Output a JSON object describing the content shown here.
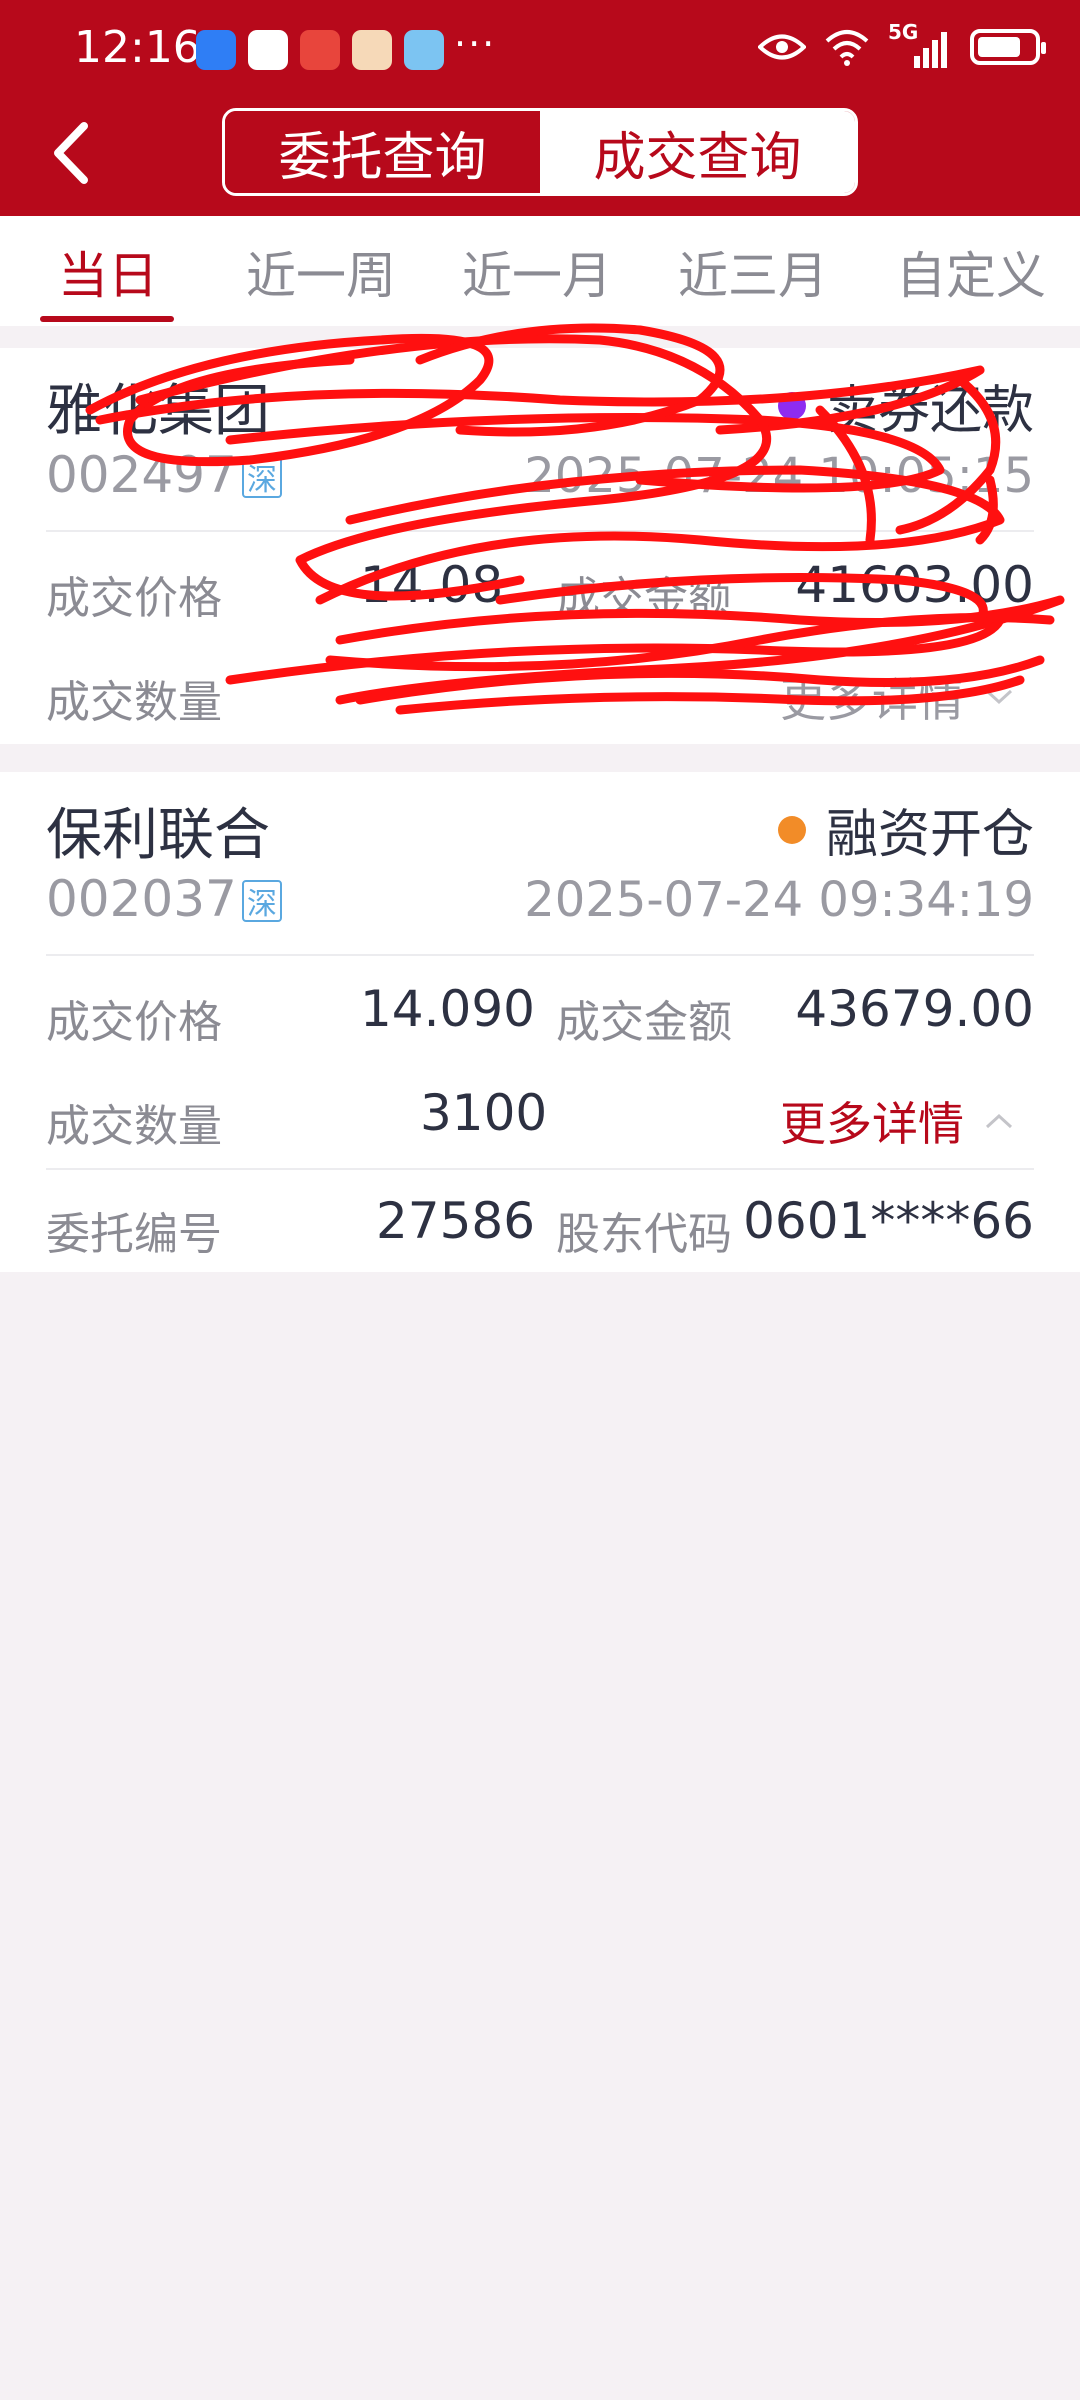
{
  "status_bar": {
    "time": "12:16",
    "more": "···",
    "network": "5G"
  },
  "header": {
    "segments": [
      "委托查询",
      "成交查询"
    ],
    "active_segment": 1
  },
  "tabs": [
    "当日",
    "近一周",
    "近一月",
    "近三月",
    "自定义"
  ],
  "active_tab": 0,
  "cards": [
    {
      "name": "雅化集团",
      "code": "002497",
      "market": "深",
      "type": "卖券还款",
      "type_color": "#8e2cf0",
      "timestamp": "2025-07-24 10:05:15",
      "labels": {
        "price": "成交价格",
        "amount": "成交金额",
        "qty": "成交数量"
      },
      "price": "14.08",
      "amount": "41603.00",
      "more": "更多详情",
      "redacted": true
    },
    {
      "name": "保利联合",
      "code": "002037",
      "market": "深",
      "type": "融资开仓",
      "type_color": "#f28c28",
      "timestamp": "2025-07-24 09:34:19",
      "labels": {
        "price": "成交价格",
        "amount": "成交金额",
        "qty": "成交数量",
        "order_no": "委托编号",
        "holder": "股东代码"
      },
      "price": "14.090",
      "amount": "43679.00",
      "qty": "3100",
      "more": "更多详情",
      "order_no": "27586",
      "holder": "0601****66"
    }
  ]
}
